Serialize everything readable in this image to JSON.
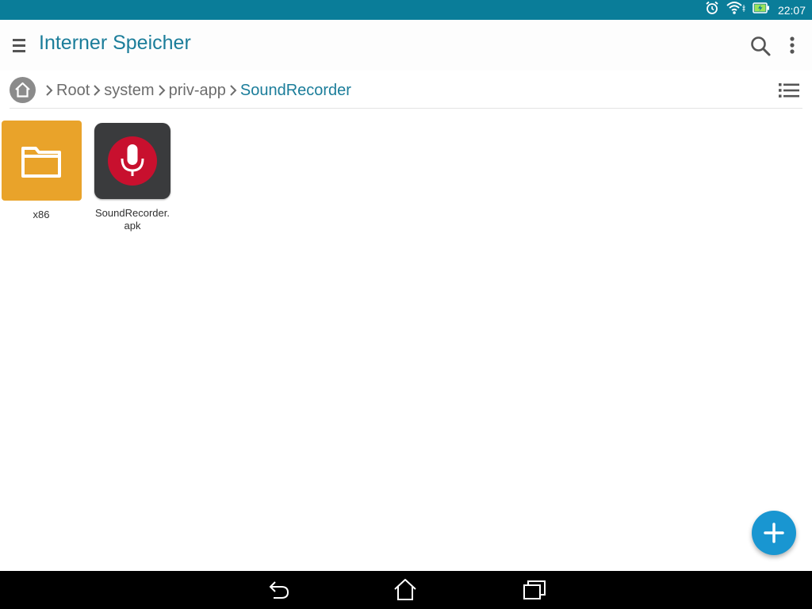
{
  "status_bar": {
    "time": "22:07",
    "icons": [
      "alarm-icon",
      "wifi-icon",
      "battery-charging-icon"
    ]
  },
  "app_bar": {
    "title": "Interner Speicher",
    "actions": [
      "search-icon",
      "more-vert-icon"
    ]
  },
  "breadcrumb": {
    "home_icon": "home-icon",
    "items": [
      "Root",
      "system",
      "priv-app",
      "SoundRecorder"
    ],
    "current_index": 3
  },
  "files": [
    {
      "name": "x86",
      "type": "folder"
    },
    {
      "name_line1": "SoundRecorder.",
      "name_line2": "apk",
      "type": "apk"
    }
  ],
  "fab": {
    "icon": "add-icon"
  },
  "nav_bar": {
    "buttons": [
      "back-icon",
      "home-icon",
      "recents-icon"
    ]
  },
  "colors": {
    "status_bar": "#0a7d99",
    "accent": "#1b7d9a",
    "folder": "#e9a32a",
    "fab": "#1996d1",
    "mic_red": "#c8102e"
  }
}
